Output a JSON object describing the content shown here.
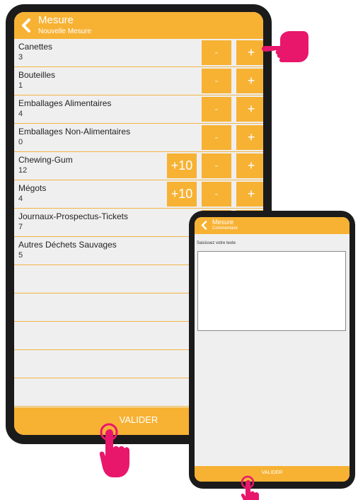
{
  "main_screen": {
    "header": {
      "title": "Mesure",
      "subtitle": "Nouvelle Mesure"
    },
    "items": [
      {
        "name": "Canettes",
        "value": "3",
        "has_plus10": false
      },
      {
        "name": "Bouteilles",
        "value": "1",
        "has_plus10": false
      },
      {
        "name": "Emballages Alimentaires",
        "value": "4",
        "has_plus10": false
      },
      {
        "name": "Emballages Non-Alimentaires",
        "value": "0",
        "has_plus10": false
      },
      {
        "name": "Chewing-Gum",
        "value": "12",
        "has_plus10": true
      },
      {
        "name": "Mégots",
        "value": "4",
        "has_plus10": true
      },
      {
        "name": "Journaux-Prospectus-Tickets",
        "value": "7",
        "has_plus10": false
      },
      {
        "name": "Autres Déchets Sauvages",
        "value": "5",
        "has_plus10": false
      }
    ],
    "buttons": {
      "plus10": "+10",
      "minus": "-",
      "plus": "+"
    },
    "validate_label": "VALIDER"
  },
  "comment_screen": {
    "header": {
      "title": "Mesure",
      "subtitle": "Commentaire"
    },
    "prompt": "Saisissez votre texte",
    "text_value": "",
    "validate_label": "VALIDER"
  },
  "colors": {
    "accent": "#f7b234",
    "pointer": "#e8176c",
    "device": "#1b1b1b",
    "background": "#efefef"
  }
}
